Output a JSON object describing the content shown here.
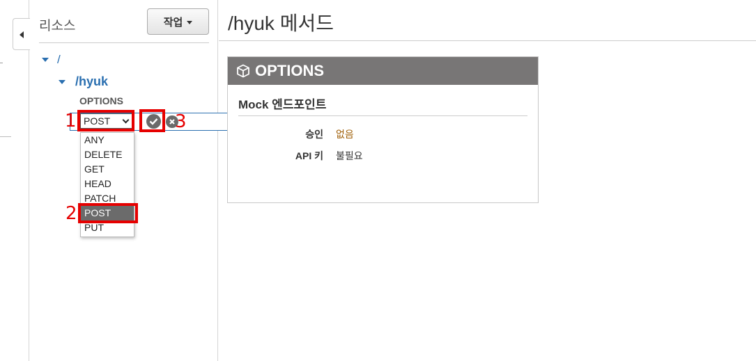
{
  "resources": {
    "title": "리소스",
    "action_button": "작업",
    "tree": {
      "root": "/",
      "child": "/hyuk",
      "method": "OPTIONS"
    },
    "method_select": {
      "value": "POST",
      "options": [
        "ANY",
        "DELETE",
        "GET",
        "HEAD",
        "PATCH",
        "POST",
        "PUT"
      ]
    }
  },
  "annotations": [
    "1",
    "2",
    "3"
  ],
  "main": {
    "title": "/hyuk 메서드",
    "panel": {
      "header": "OPTIONS",
      "subtitle": "Mock 엔드포인트",
      "auth_label": "승인",
      "auth_value": "없음",
      "apikey_label": "API 키",
      "apikey_value": "불필요"
    }
  },
  "colors": {
    "annotation": "#e60000",
    "tree_link": "#2a6fb0",
    "panel_header": "#787676",
    "auth_value": "#a0600a"
  }
}
